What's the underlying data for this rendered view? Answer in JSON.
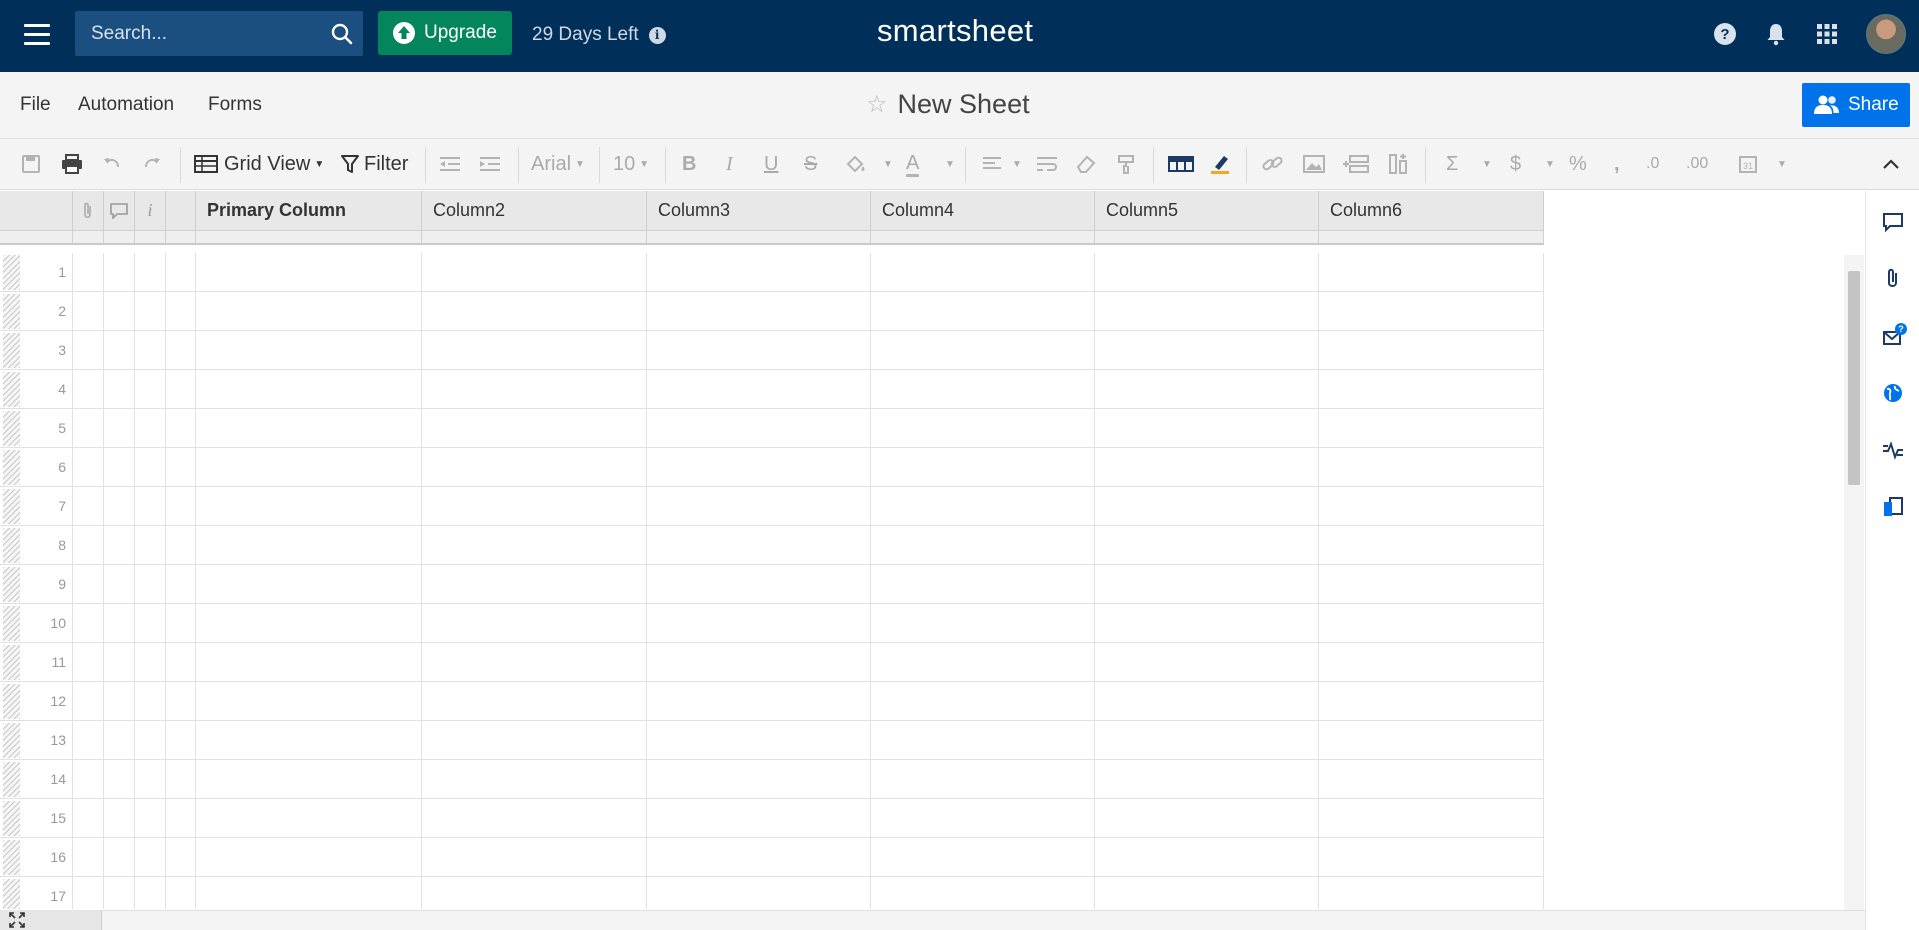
{
  "topbar": {
    "search_placeholder": "Search...",
    "upgrade_label": "Upgrade",
    "trial_text": "29 Days Left",
    "info_glyph": "i",
    "logo": "smartsheet",
    "help_glyph": "?",
    "colors": {
      "bg": "#003059",
      "upgrade": "#03865c"
    }
  },
  "menubar": {
    "items": [
      "File",
      "Automation",
      "Forms"
    ],
    "sheet_title": "New Sheet",
    "star_glyph": "☆",
    "share_label": "Share",
    "share_color": "#0073ea"
  },
  "toolbar": {
    "view_label": "Grid View",
    "filter_label": "Filter",
    "font_family": "Arial",
    "font_size": "10",
    "bold": "B",
    "italic": "I",
    "underline": "U",
    "strike": "S",
    "text_color": "A",
    "sum": "Σ",
    "currency": "$",
    "percent": "%",
    "comma": ",",
    "dec_less": ".0",
    "dec_more": ".00",
    "collapse": "^"
  },
  "grid": {
    "info_header": "i",
    "columns": [
      "Primary Column",
      "Column2",
      "Column3",
      "Column4",
      "Column5",
      "Column6"
    ],
    "row_numbers": [
      "1",
      "2",
      "3",
      "4",
      "5",
      "6",
      "7",
      "8",
      "9",
      "10",
      "11",
      "12",
      "13",
      "14",
      "15",
      "16",
      "17"
    ]
  },
  "right_panel": {
    "icons": [
      "comment-icon",
      "attachment-icon",
      "update-requests-icon",
      "publish-icon",
      "activity-log-icon",
      "summary-icon"
    ],
    "badge": "?"
  }
}
